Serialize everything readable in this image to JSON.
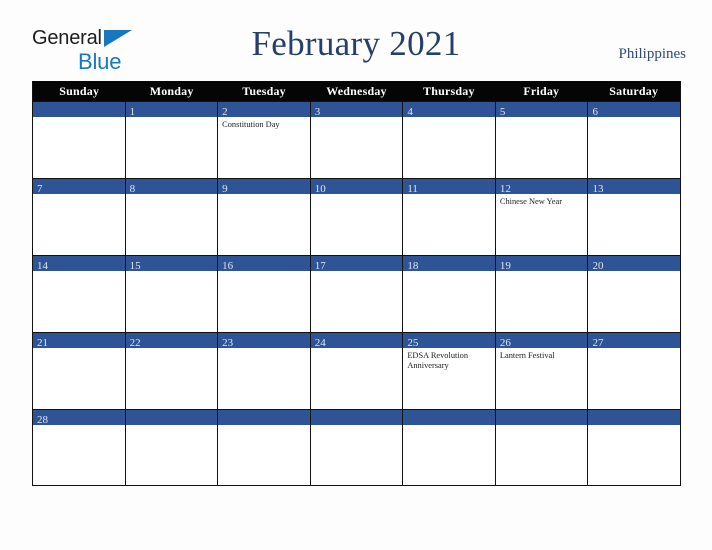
{
  "brand": {
    "name_part1": "General",
    "name_part2": "Blue",
    "triangle_icon": "triangle-icon",
    "accent_color": "#1878be"
  },
  "header": {
    "title": "February 2021",
    "country": "Philippines",
    "title_color": "#243f6b"
  },
  "calendar": {
    "month": "February",
    "year": "2021",
    "weekday_headers": [
      "Sunday",
      "Monday",
      "Tuesday",
      "Wednesday",
      "Thursday",
      "Friday",
      "Saturday"
    ],
    "header_bg": "#050505",
    "date_band_color": "#2e5496",
    "cell_bg": "#ffffff",
    "border_color": "#121212",
    "weeks": [
      [
        {
          "date": "",
          "events": []
        },
        {
          "date": "1",
          "events": []
        },
        {
          "date": "2",
          "events": [
            "Constitution Day"
          ]
        },
        {
          "date": "3",
          "events": []
        },
        {
          "date": "4",
          "events": []
        },
        {
          "date": "5",
          "events": []
        },
        {
          "date": "6",
          "events": []
        }
      ],
      [
        {
          "date": "7",
          "events": []
        },
        {
          "date": "8",
          "events": []
        },
        {
          "date": "9",
          "events": []
        },
        {
          "date": "10",
          "events": []
        },
        {
          "date": "11",
          "events": []
        },
        {
          "date": "12",
          "events": [
            "Chinese New Year"
          ]
        },
        {
          "date": "13",
          "events": []
        }
      ],
      [
        {
          "date": "14",
          "events": []
        },
        {
          "date": "15",
          "events": []
        },
        {
          "date": "16",
          "events": []
        },
        {
          "date": "17",
          "events": []
        },
        {
          "date": "18",
          "events": []
        },
        {
          "date": "19",
          "events": []
        },
        {
          "date": "20",
          "events": []
        }
      ],
      [
        {
          "date": "21",
          "events": []
        },
        {
          "date": "22",
          "events": []
        },
        {
          "date": "23",
          "events": []
        },
        {
          "date": "24",
          "events": []
        },
        {
          "date": "25",
          "events": [
            "EDSA Revolution Anniversary"
          ]
        },
        {
          "date": "26",
          "events": [
            "Lantern Festival"
          ]
        },
        {
          "date": "27",
          "events": []
        }
      ],
      [
        {
          "date": "28",
          "events": []
        },
        {
          "date": "",
          "events": []
        },
        {
          "date": "",
          "events": []
        },
        {
          "date": "",
          "events": []
        },
        {
          "date": "",
          "events": []
        },
        {
          "date": "",
          "events": []
        },
        {
          "date": "",
          "events": []
        }
      ]
    ]
  }
}
